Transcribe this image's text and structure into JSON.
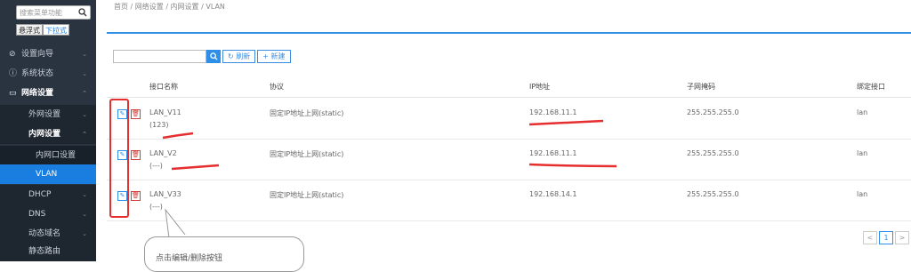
{
  "sidebar": {
    "search_placeholder": "搜索菜单功能",
    "modes": [
      "悬浮式",
      "下拉式"
    ],
    "items": [
      {
        "label": "设置向导",
        "icon": "compass-icon"
      },
      {
        "label": "系统状态",
        "icon": "info-icon"
      },
      {
        "label": "网络设置",
        "icon": "monitor-icon"
      },
      {
        "label": "外网设置"
      },
      {
        "label": "内网设置"
      },
      {
        "label": "内网口设置"
      },
      {
        "label": "VLAN"
      },
      {
        "label": "DHCP"
      },
      {
        "label": "DNS"
      },
      {
        "label": "动态域名"
      },
      {
        "label": "静态路由"
      }
    ]
  },
  "breadcrumb": "首页 / 网络设置 / 内网设置 / VLAN",
  "toolbar": {
    "refresh": "刷新",
    "new": "新建"
  },
  "table": {
    "headers": [
      "接口名称",
      "协议",
      "IP地址",
      "子网掩码",
      "绑定接口"
    ],
    "rows": [
      {
        "name": "LAN_V11",
        "sub": "(123)",
        "protocol": "固定IP地址上网(static)",
        "ip": "192.168.11.1",
        "mask": "255.255.255.0",
        "bind": "lan"
      },
      {
        "name": "LAN_V2",
        "sub": "(---)",
        "protocol": "固定IP地址上网(static)",
        "ip": "192.168.11.1",
        "mask": "255.255.255.0",
        "bind": "lan"
      },
      {
        "name": "LAN_V33",
        "sub": "(---)",
        "protocol": "固定IP地址上网(static)",
        "ip": "192.168.14.1",
        "mask": "255.255.255.0",
        "bind": "lan"
      }
    ]
  },
  "pager": {
    "prev": "<",
    "current": "1",
    "next": ">"
  },
  "annotation": {
    "bubble_text": "点击编辑/删除按钮"
  },
  "colors": {
    "accent": "#1a7ee0",
    "sidebar": "#2a3440",
    "danger": "#d0403a",
    "annotation": "#e62e2e"
  }
}
